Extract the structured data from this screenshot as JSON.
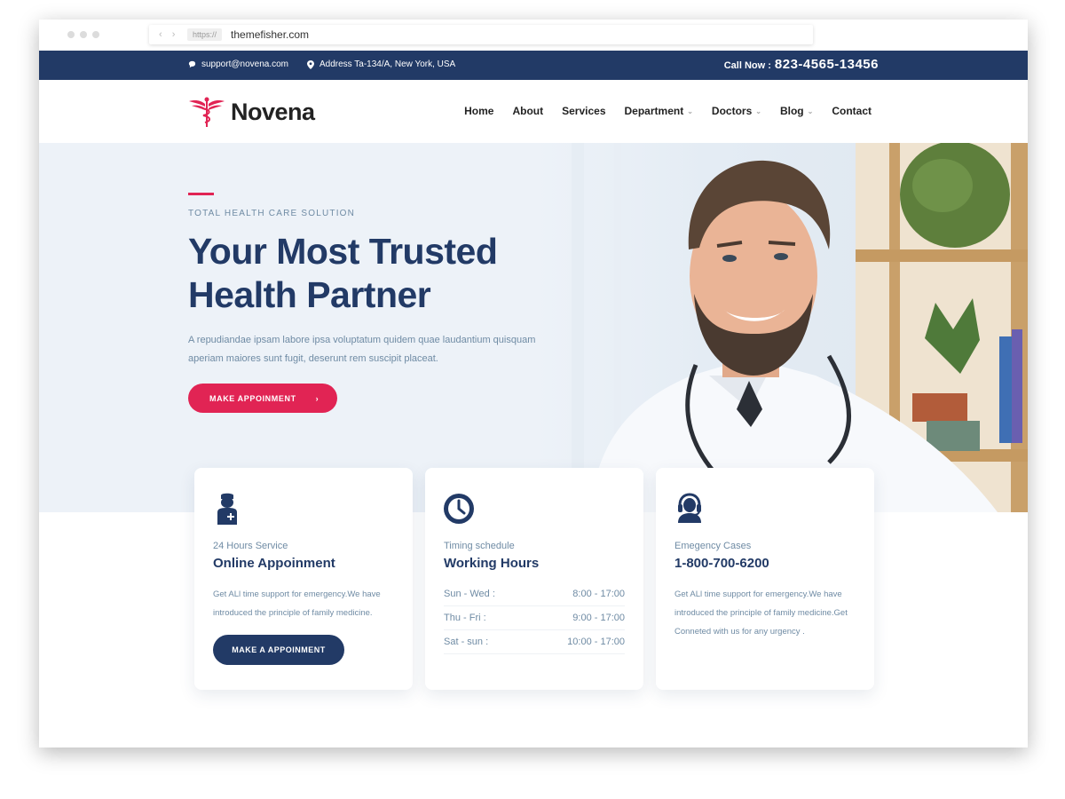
{
  "browser": {
    "protocol": "https://",
    "url": "themefisher.com"
  },
  "topbar": {
    "email": "support@novena.com",
    "address": "Address Ta-134/A, New York, USA",
    "call_label": "Call Now :",
    "call_number": "823-4565-13456"
  },
  "brand": {
    "name": "Novena",
    "accent_color": "#e12454",
    "primary_color": "#223a66"
  },
  "nav": {
    "items": [
      {
        "label": "Home",
        "has_dropdown": false
      },
      {
        "label": "About",
        "has_dropdown": false
      },
      {
        "label": "Services",
        "has_dropdown": false
      },
      {
        "label": "Department",
        "has_dropdown": true
      },
      {
        "label": "Doctors",
        "has_dropdown": true
      },
      {
        "label": "Blog",
        "has_dropdown": true
      },
      {
        "label": "Contact",
        "has_dropdown": false
      }
    ]
  },
  "hero": {
    "tagline": "TOTAL HEALTH CARE SOLUTION",
    "title_line1": "Your Most Trusted",
    "title_line2": "Health Partner",
    "description": "A repudiandae ipsam labore ipsa voluptatum quidem quae laudantium quisquam aperiam maiores sunt fugit, deserunt rem suscipit placeat.",
    "button_label": "MAKE APPOINMENT",
    "button_icon": "chevron-right-icon"
  },
  "cards": [
    {
      "icon": "doctor-icon",
      "subtitle": "24 Hours Service",
      "title": "Online Appoinment",
      "text": "Get ALl time support for emergency.We have introduced the principle of family medicine.",
      "button_label": "MAKE A APPOINMENT"
    },
    {
      "icon": "clock-icon",
      "subtitle": "Timing schedule",
      "title": "Working Hours",
      "schedule": [
        {
          "days": "Sun - Wed :",
          "hours": "8:00 - 17:00"
        },
        {
          "days": "Thu - Fri :",
          "hours": "9:00 - 17:00"
        },
        {
          "days": "Sat - sun :",
          "hours": "10:00 - 17:00"
        }
      ]
    },
    {
      "icon": "headset-icon",
      "subtitle": "Emegency Cases",
      "title": "1-800-700-6200",
      "text": "Get ALl time support for emergency.We have introduced the principle of family medicine.Get Conneted with us for any urgency ."
    }
  ]
}
